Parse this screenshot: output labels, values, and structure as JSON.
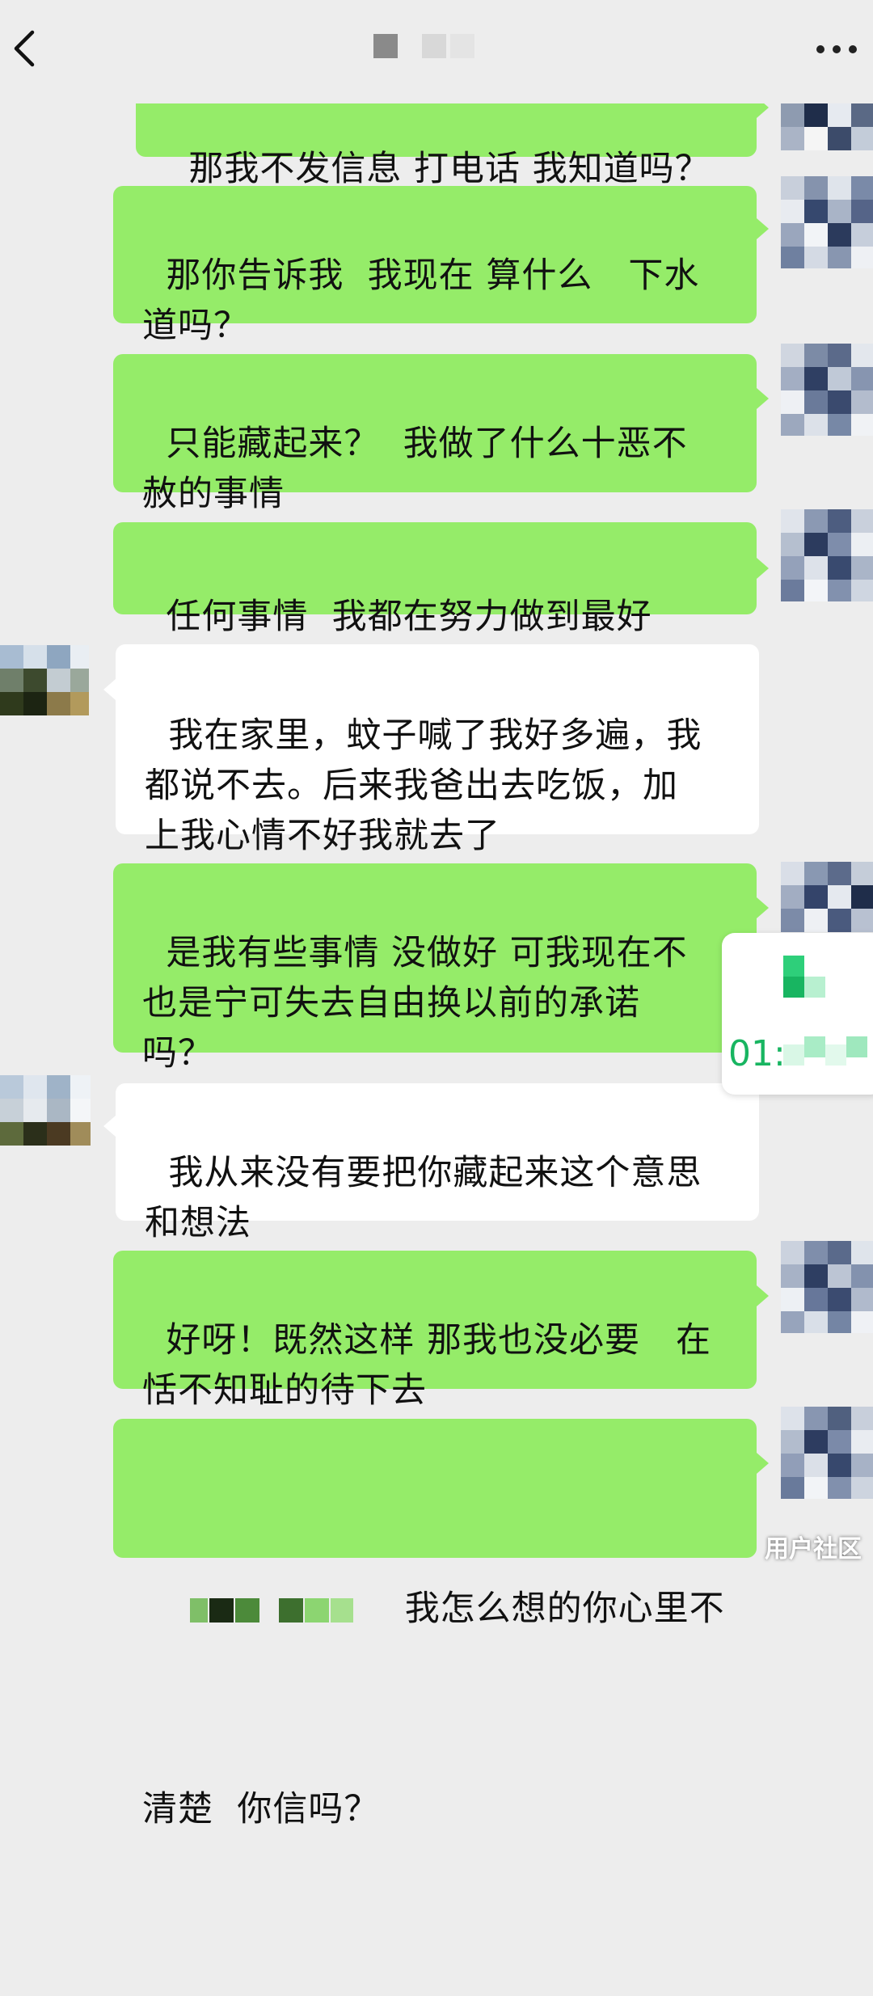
{
  "header": {
    "back_icon": "chevron-left-icon",
    "title_redacted": true,
    "more_icon": "more-dots-icon"
  },
  "colors": {
    "sent_bubble": "#95ec69",
    "received_bubble": "#ffffff",
    "background": "#ededed",
    "time_accent": "#18b561"
  },
  "messages": [
    {
      "side": "right",
      "text": "那我不发信息 打电话 我知道吗？"
    },
    {
      "side": "right",
      "text": "那你告诉我  我现在 算什么   下水\n道吗？"
    },
    {
      "side": "right",
      "text": "只能藏起来？  我做了什么十恶不\n赦的事情"
    },
    {
      "side": "right",
      "text": "任何事情  我都在努力做到最好"
    },
    {
      "side": "left",
      "text": "我在家里，蚊子喊了我好多遍，我\n都说不去。后来我爸出去吃饭，加\n上我心情不好我就去了"
    },
    {
      "side": "right",
      "text": "是我有些事情 没做好 可我现在不\n也是宁可失去自由换以前的承诺\n吗？"
    },
    {
      "side": "left",
      "text": "我从来没有要把你藏起来这个意思\n和想法"
    },
    {
      "side": "right",
      "text": "好呀！既然这样 那我也没必要   在\n恬不知耻的待下去"
    },
    {
      "side": "right",
      "text_after_redaction": "我怎么想的你心里不",
      "text_line2": "清楚  你信吗？"
    }
  ],
  "floating_card": {
    "time_text": "01:"
  },
  "watermark": {
    "text": "用户社区"
  }
}
